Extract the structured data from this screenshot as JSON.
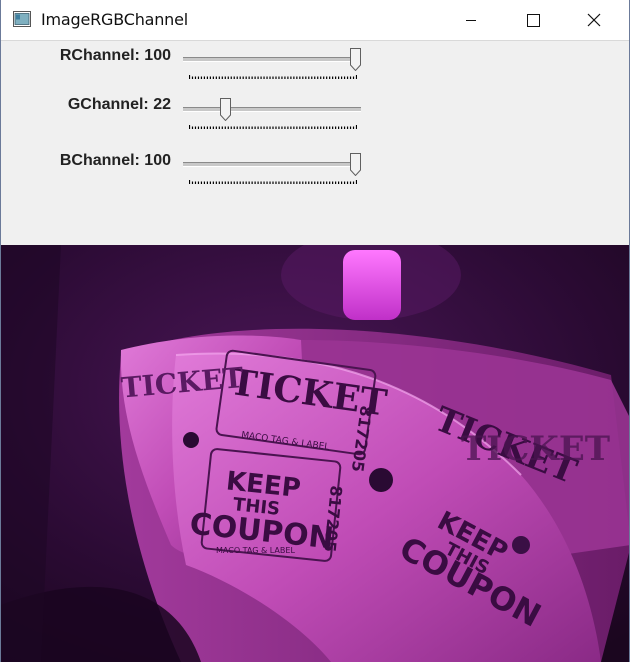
{
  "window": {
    "title": "ImageRGBChannel",
    "icon": "app-window-icon",
    "buttons": [
      "minimize-icon",
      "maximize-icon",
      "close-icon"
    ]
  },
  "channels": [
    {
      "label": "RChannel: 100",
      "value": 100,
      "max": 100
    },
    {
      "label": "GChannel: 22",
      "value": 22,
      "max": 100
    },
    {
      "label": "BChannel: 100",
      "value": 100,
      "max": 100
    }
  ],
  "image": {
    "ticket_top": "TICKET",
    "ticket_number": "817205",
    "keep_line1": "KEEP",
    "keep_line2": "THIS",
    "keep_line3": "COUPON",
    "maker": "MACO TAG & LABEL",
    "tint": "#c23ab8"
  }
}
